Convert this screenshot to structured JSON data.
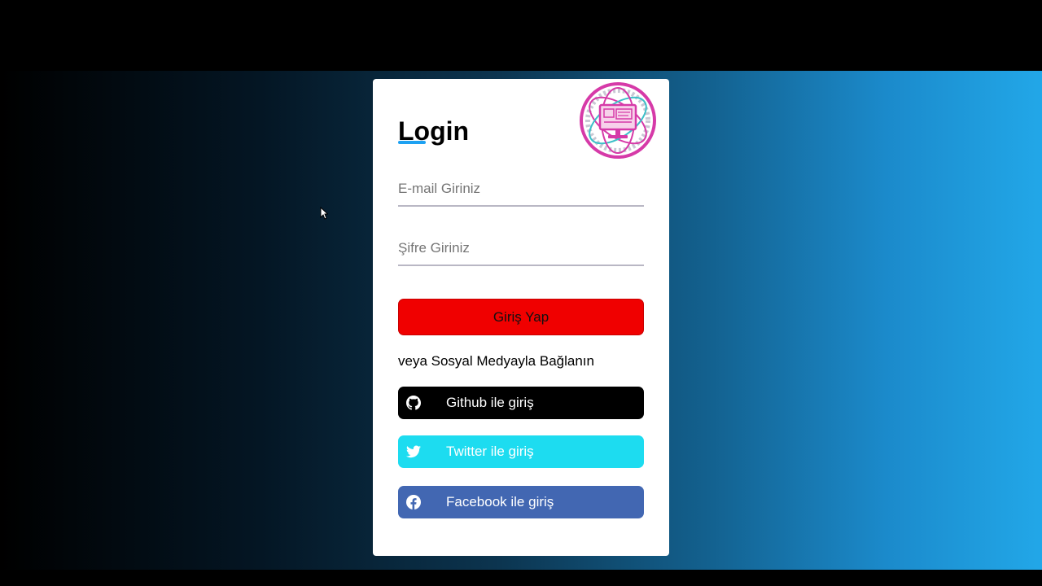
{
  "login": {
    "title": "Login",
    "email_placeholder": "E-mail Giriniz",
    "password_placeholder": "Şifre Giriniz",
    "submit_label": "Giriş Yap",
    "social_prompt": "veya Sosyal Medyayla Bağlanın"
  },
  "social": {
    "github_label": "Github ile giriş",
    "twitter_label": "Twitter ile giriş",
    "facebook_label": "Facebook ile giriş"
  },
  "colors": {
    "submit": "#f00000",
    "github": "#000000",
    "twitter": "#1ddcf0",
    "facebook": "#4267b2",
    "title_accent": "#1da1f2",
    "logo_ring": "#d63aa8"
  },
  "icons": {
    "logo": "computer-screen-logo-icon",
    "github": "github-icon",
    "twitter": "twitter-icon",
    "facebook": "facebook-icon",
    "cursor": "mouse-pointer-icon"
  }
}
